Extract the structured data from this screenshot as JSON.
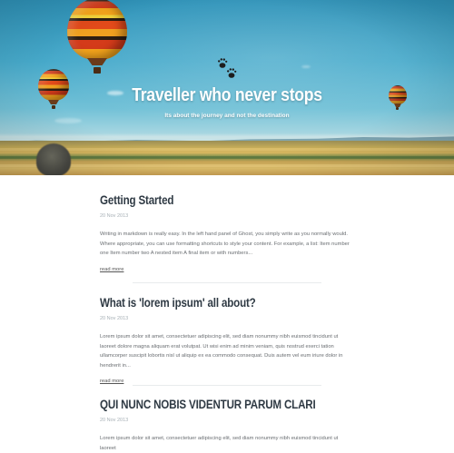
{
  "blog": {
    "title": "Traveller who never stops",
    "description": "Its about the journey and not the destination"
  },
  "posts": [
    {
      "title": "Getting Started",
      "date": "20 Nov 2013",
      "excerpt": "Writing in markdown is really easy. In the left hand panel of Ghost, you simply write as you normally would. Where appropriate, you can use formatting shortcuts to style your content. For example, a list: Item number one Item number two A nested item A final item or with numbers...",
      "read_more": "read more"
    },
    {
      "title": "What is 'lorem ipsum' all about?",
      "date": "20 Nov 2013",
      "excerpt": "Lorem ipsum dolor sit amet, consectetuer adipiscing elit, sed diam nonummy nibh euismod tincidunt ut laoreet dolore magna aliquam erat volutpat. Ut wisi enim ad minim veniam, quis nostrud exerci tation ullamcorper suscipit lobortis nisl ut aliquip ex ea commodo consequat. Duis autem vel eum iriure dolor in hendrerit in...",
      "read_more": "read more"
    },
    {
      "title": "QUI NUNC NOBIS VIDENTUR PARUM CLARI",
      "date": "20 Nov 2013",
      "excerpt": "Lorem ipsum dolor sit amet, consectetuer adipiscing elit, sed diam nonummy nibh euismod tincidunt ut laoreet"
    }
  ],
  "icons": {
    "logo": "paw-prints-icon"
  },
  "colors": {
    "title_text": "#2f3a44",
    "date_text": "#a7b0b6",
    "body_text": "#6a6e72",
    "sky": "#47aacb"
  }
}
